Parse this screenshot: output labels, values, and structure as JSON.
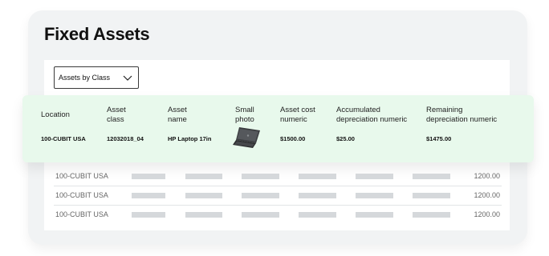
{
  "page": {
    "title": "Fixed Assets"
  },
  "filter": {
    "selected": "Assets by Class",
    "icon": "chevron-down-icon"
  },
  "highlighted_row": {
    "headers": {
      "location": "Location",
      "asset_class": [
        "Asset",
        "class"
      ],
      "asset_name": [
        "Asset",
        "name"
      ],
      "small_photo": [
        "Small",
        "photo"
      ],
      "asset_cost": [
        "Asset cost",
        "numeric"
      ],
      "accumulated": [
        "Accumulated",
        "depreciation numeric"
      ],
      "remaining": [
        "Remaining",
        "depreciation numeric"
      ]
    },
    "values": {
      "location": "100-CUBIT USA",
      "asset_class": "12032018_04",
      "asset_name": "HP Laptop 17in",
      "asset_cost": "$1500.00",
      "accumulated": "$25.00",
      "remaining": "$1475.00"
    },
    "photo_icon": "laptop-icon"
  },
  "rows": [
    {
      "location": "100-CUBIT USA",
      "amount": "1200.00"
    },
    {
      "location": "100-CUBIT USA",
      "amount": "1200.00"
    },
    {
      "location": "100-CUBIT USA",
      "amount": "1200.00"
    }
  ],
  "colors": {
    "highlight_bg": "#e8f9ec",
    "card_bg": "#f1f3f4",
    "placeholder": "#d5d8db"
  }
}
